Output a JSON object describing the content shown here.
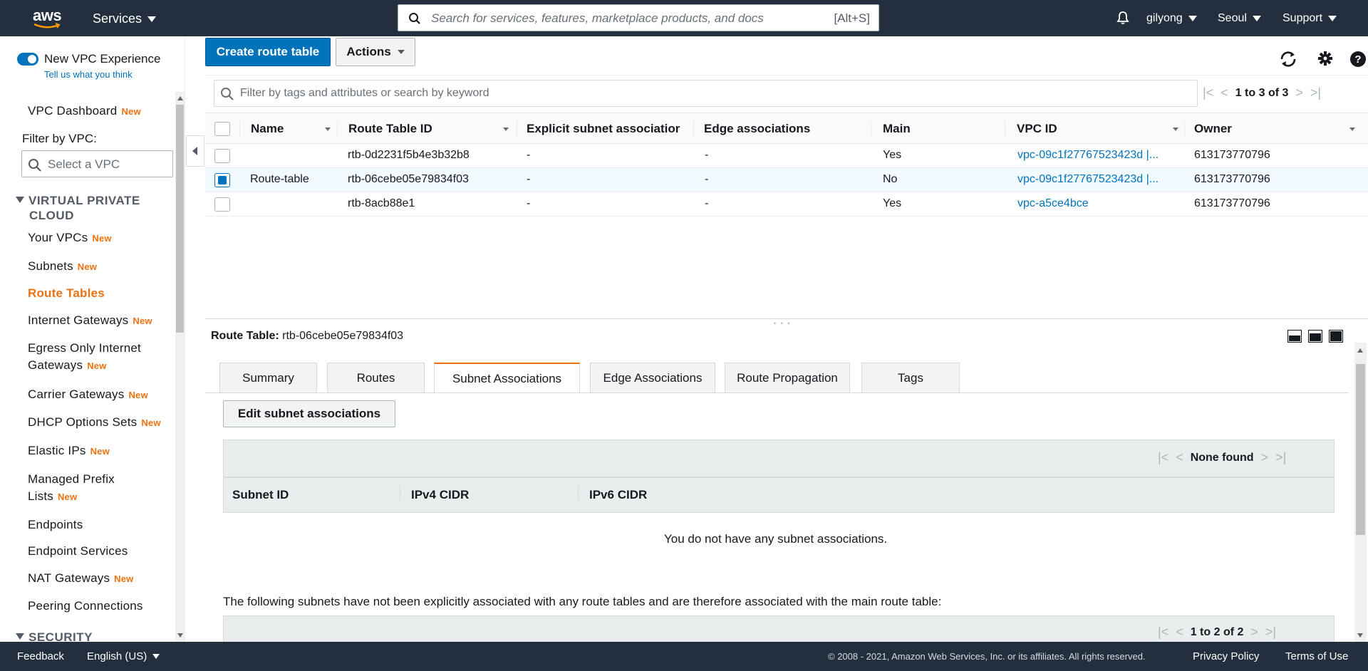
{
  "topnav": {
    "logo_text": "aws",
    "services_label": "Services",
    "search_placeholder": "Search for services, features, marketplace products, and docs",
    "search_shortcut": "[Alt+S]",
    "user": "gilyong",
    "region": "Seoul",
    "support": "Support",
    "bg_color": "#232f3e"
  },
  "sidebar": {
    "new_experience": "New VPC Experience",
    "tell_us": "Tell us what you think",
    "dashboard": "VPC Dashboard",
    "new_badge": "New",
    "filter_label": "Filter by VPC:",
    "filter_placeholder": "Select a VPC",
    "section_vpc": "VIRTUAL PRIVATE CLOUD",
    "section_vpc_line1": "VIRTUAL PRIVATE",
    "section_vpc_line2": "CLOUD",
    "section_security": "SECURITY",
    "items": [
      {
        "label": "Your VPCs",
        "badge": "New"
      },
      {
        "label": "Subnets",
        "badge": "New"
      },
      {
        "label": "Route Tables",
        "badge": ""
      },
      {
        "label": "Internet Gateways",
        "badge": "New"
      },
      {
        "label": "Egress Only Internet",
        "label2": "Gateways",
        "badge": "New"
      },
      {
        "label": "Carrier Gateways",
        "badge": "New"
      },
      {
        "label": "DHCP Options Sets",
        "badge": "New"
      },
      {
        "label": "Elastic IPs",
        "badge": "New"
      },
      {
        "label": "Managed Prefix",
        "label2": "Lists",
        "badge": "New"
      },
      {
        "label": "Endpoints",
        "badge": ""
      },
      {
        "label": "Endpoint Services",
        "badge": ""
      },
      {
        "label": "NAT Gateways",
        "badge": "New"
      },
      {
        "label": "Peering Connections",
        "badge": ""
      }
    ],
    "active_item": "Route Tables"
  },
  "toolbar": {
    "create_label": "Create route table",
    "actions_label": "Actions"
  },
  "filter": {
    "placeholder": "Filter by tags and attributes or search by keyword",
    "pager_text": "1 to 3 of 3"
  },
  "table": {
    "columns": [
      "Name",
      "Route Table ID",
      "Explicit subnet associatior",
      "Edge associations",
      "Main",
      "VPC ID",
      "Owner"
    ],
    "rows": [
      {
        "name": "",
        "id": "rtb-0d2231f5b4e3b32b8",
        "explicit": "-",
        "edge": "-",
        "main": "Yes",
        "vpc": "vpc-09c1f27767523423d |...",
        "owner": "613173770796",
        "selected": false
      },
      {
        "name": "Route-table",
        "id": "rtb-06cebe05e79834f03",
        "explicit": "-",
        "edge": "-",
        "main": "No",
        "vpc": "vpc-09c1f27767523423d |...",
        "owner": "613173770796",
        "selected": true
      },
      {
        "name": "",
        "id": "rtb-8acb88e1",
        "explicit": "-",
        "edge": "-",
        "main": "Yes",
        "vpc": "vpc-a5ce4bce",
        "owner": "613173770796",
        "selected": false
      }
    ]
  },
  "detail": {
    "title_label": "Route Table:",
    "title_value": "rtb-06cebe05e79834f03",
    "tabs": [
      "Summary",
      "Routes",
      "Subnet Associations",
      "Edge Associations",
      "Route Propagation",
      "Tags"
    ],
    "active_tab": "Subnet Associations",
    "edit_label": "Edit subnet associations",
    "pager1_text": "None found",
    "sub_columns": [
      "Subnet ID",
      "IPv4 CIDR",
      "IPv6 CIDR"
    ],
    "empty_text": "You do not have any subnet associations.",
    "following_text": "The following subnets have not been explicitly associated with any route tables and are therefore associated with the main route table:",
    "pager2_text": "1 to 2 of 2"
  },
  "footer": {
    "feedback": "Feedback",
    "language": "English (US)",
    "copyright": "© 2008 - 2021, Amazon Web Services, Inc. or its affiliates. All rights reserved.",
    "privacy": "Privacy Policy",
    "terms": "Terms of Use"
  },
  "colors": {
    "accent": "#ec7211",
    "link": "#0073bb",
    "nav_bg": "#232f3e"
  }
}
